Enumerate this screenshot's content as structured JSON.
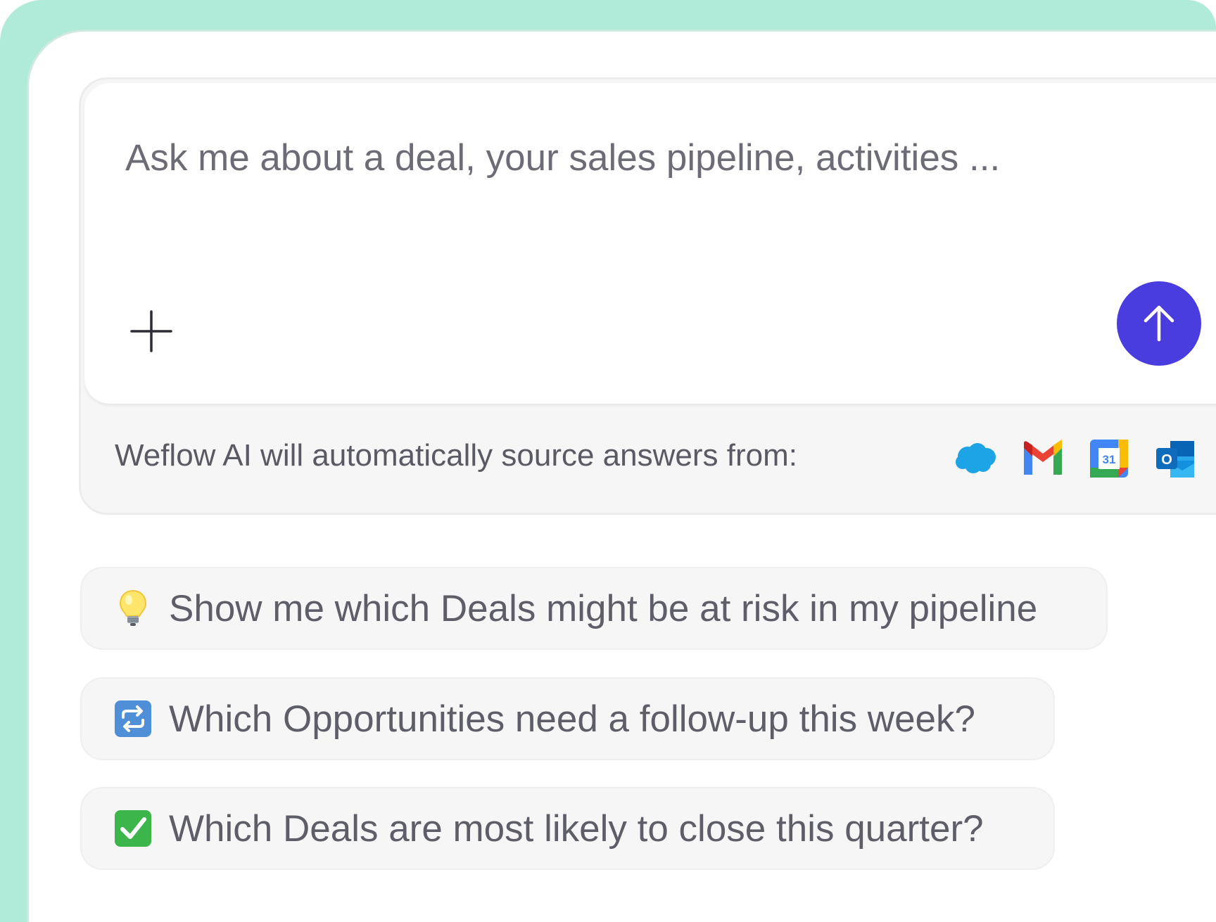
{
  "composer": {
    "input_placeholder": "Ask me about a deal, your sales pipeline, activities ...",
    "input_value": "",
    "attach_icon": "plus-icon",
    "send_icon": "arrow-up-icon",
    "send_color": "#4a3de0",
    "sources_label": "Weflow AI will automatically source answers from:",
    "sources": [
      {
        "icon": "salesforce-icon"
      },
      {
        "icon": "gmail-icon"
      },
      {
        "icon": "google-calendar-icon",
        "text": "31"
      },
      {
        "icon": "outlook-icon",
        "text": "O"
      }
    ]
  },
  "suggestions": [
    {
      "emoji": "lightbulb-icon",
      "text": "Show me which Deals might be at risk in my pipeline"
    },
    {
      "emoji": "repeat-icon",
      "text": "Which Opportunities need a follow-up this week?"
    },
    {
      "emoji": "check-mark-icon",
      "text": "Which Deals are most likely to close this quarter?"
    }
  ],
  "colors": {
    "frame": "#b0ead8",
    "accent": "#4a3de0",
    "text": "#5e5e69"
  }
}
